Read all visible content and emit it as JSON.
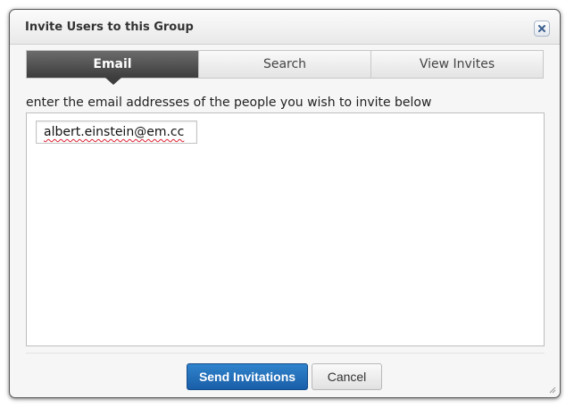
{
  "dialog": {
    "title": "Invite Users to this Group",
    "close_icon": "close-icon"
  },
  "tabs": [
    {
      "label": "Email",
      "active": true
    },
    {
      "label": "Search",
      "active": false
    },
    {
      "label": "View Invites",
      "active": false
    }
  ],
  "email_panel": {
    "instructions": "enter the email addresses of the people you wish to invite below",
    "emails": [
      "albert.einstein@em.cc"
    ]
  },
  "buttons": {
    "send_label": "Send Invitations",
    "cancel_label": "Cancel"
  },
  "colors": {
    "primary": "#1f6db8",
    "active_tab": "#4a4a4a"
  }
}
